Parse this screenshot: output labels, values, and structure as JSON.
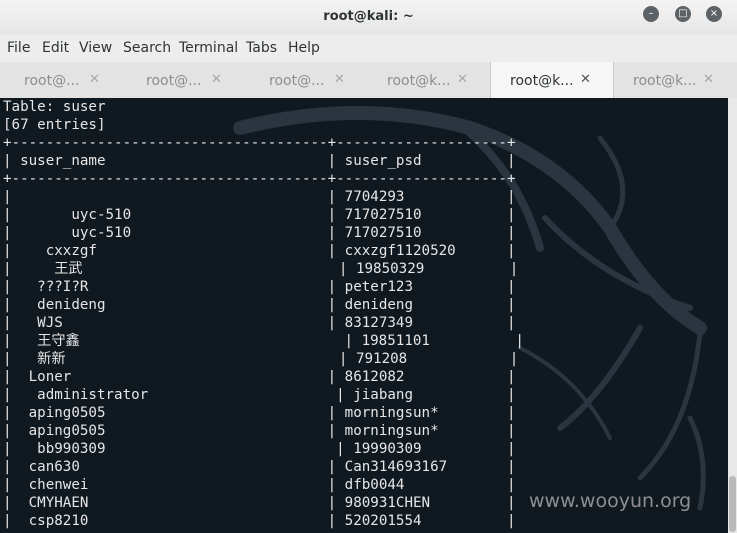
{
  "window": {
    "title": "root@kali: ~"
  },
  "menu": [
    "File",
    "Edit",
    "View",
    "Search",
    "Terminal",
    "Tabs",
    "Help"
  ],
  "tabs": [
    {
      "label": "root@...",
      "active": false
    },
    {
      "label": "root@...",
      "active": false
    },
    {
      "label": "root@...",
      "active": false
    },
    {
      "label": "root@k...",
      "active": false
    },
    {
      "label": "root@k...",
      "active": true
    },
    {
      "label": "root@k...",
      "active": false
    }
  ],
  "terminal": {
    "lines": [
      "Table: suser",
      "[67 entries]",
      "+-------------------------------------+--------------------+",
      "| suser_name                          | suser_psd          |",
      "+-------------------------------------+--------------------+",
      "|                                     | 7704293            |",
      "|       uyc-510                       | 717027510          |",
      "|       uyc-510                       | 717027510          |",
      "|    cxxzgf                           | cxxzgf1120520      |",
      "|     王武                              | 19850329          |",
      "|   ???I?R                            | peter123           |",
      "|   denideng                          | denideng           |",
      "|   WJS                               | 83127349           |",
      "|   王守鑫                               | 19851101          |",
      "|   新新                                | 791208            |",
      "|  Loner                              | 8612082            |",
      "|   administrator                      | jiabang           |",
      "|  aping0505                          | morningsun*        |",
      "|  aping0505                          | morningsun*        |",
      "|   bb990309                           | 19990309          |",
      "|  can630                             | Can314693167       |",
      "|  chenwei                            | dfb0044            |",
      "|  CMYHAEN                            | 980931CHEN         |",
      "|  csp8210                            | 520201554          |"
    ]
  },
  "watermark": "www.wooyun.org"
}
